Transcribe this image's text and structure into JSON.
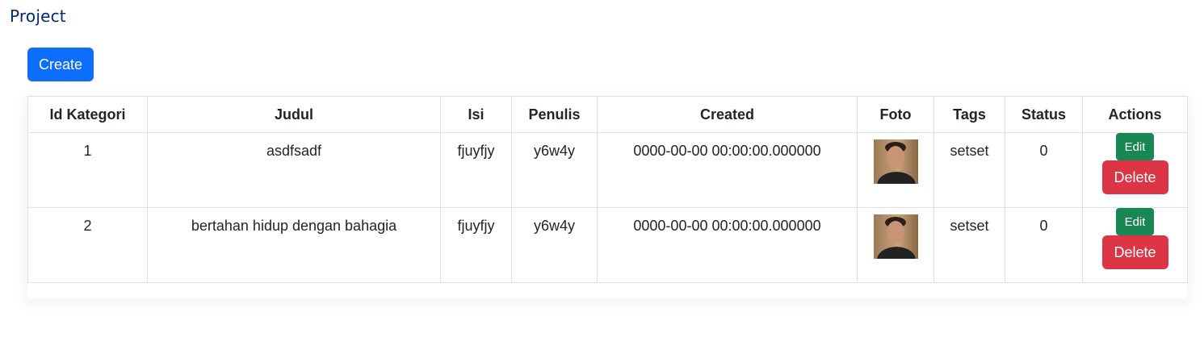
{
  "page": {
    "title": "Project"
  },
  "toolbar": {
    "create_label": "Create"
  },
  "table": {
    "headers": [
      "Id Kategori",
      "Judul",
      "Isi",
      "Penulis",
      "Created",
      "Foto",
      "Tags",
      "Status",
      "Actions"
    ],
    "rows": [
      {
        "id_kategori": "1",
        "judul": "asdfsadf",
        "isi": "fjuyfjy",
        "penulis": "y6w4y",
        "created": "0000-00-00 00:00:00.000000",
        "tags": "setset",
        "status": "0",
        "edit_label": "Edit",
        "delete_label": "Delete"
      },
      {
        "id_kategori": "2",
        "judul": "bertahan hidup dengan bahagia",
        "isi": "fjuyfjy",
        "penulis": "y6w4y",
        "created": "0000-00-00 00:00:00.000000",
        "tags": "setset",
        "status": "0",
        "edit_label": "Edit",
        "delete_label": "Delete"
      }
    ]
  },
  "colors": {
    "title": "#012970",
    "primary": "#0d6efd",
    "success": "#198754",
    "danger": "#dc3545"
  }
}
